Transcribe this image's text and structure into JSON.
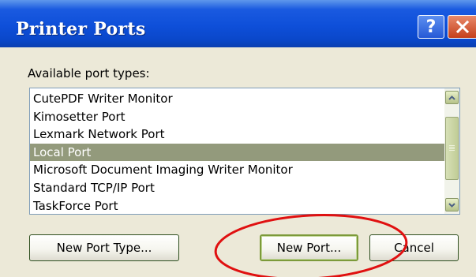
{
  "window": {
    "title": "Printer Ports",
    "help_glyph": "?"
  },
  "ports": {
    "label": "Available port types:",
    "items": [
      "CutePDF Writer Monitor",
      "Kimosetter Port",
      "Lexmark Network Port",
      "Local Port",
      "Microsoft Document Imaging Writer Monitor",
      "Standard TCP/IP Port",
      "TaskForce Port"
    ],
    "selected_index": 3
  },
  "buttons": {
    "new_port_type": "New Port Type...",
    "new_port": "New Port...",
    "cancel": "Cancel"
  },
  "annotation": {
    "color": "#e01010",
    "highlight": "new-port-button"
  },
  "colors": {
    "titlebar": "#0e4fd9",
    "dialog_bg": "#ece9d8",
    "selection": "#939a7c",
    "close_button": "#d0542f"
  },
  "icons": [
    "help-icon",
    "close-icon",
    "scroll-up-icon",
    "scroll-down-icon"
  ]
}
